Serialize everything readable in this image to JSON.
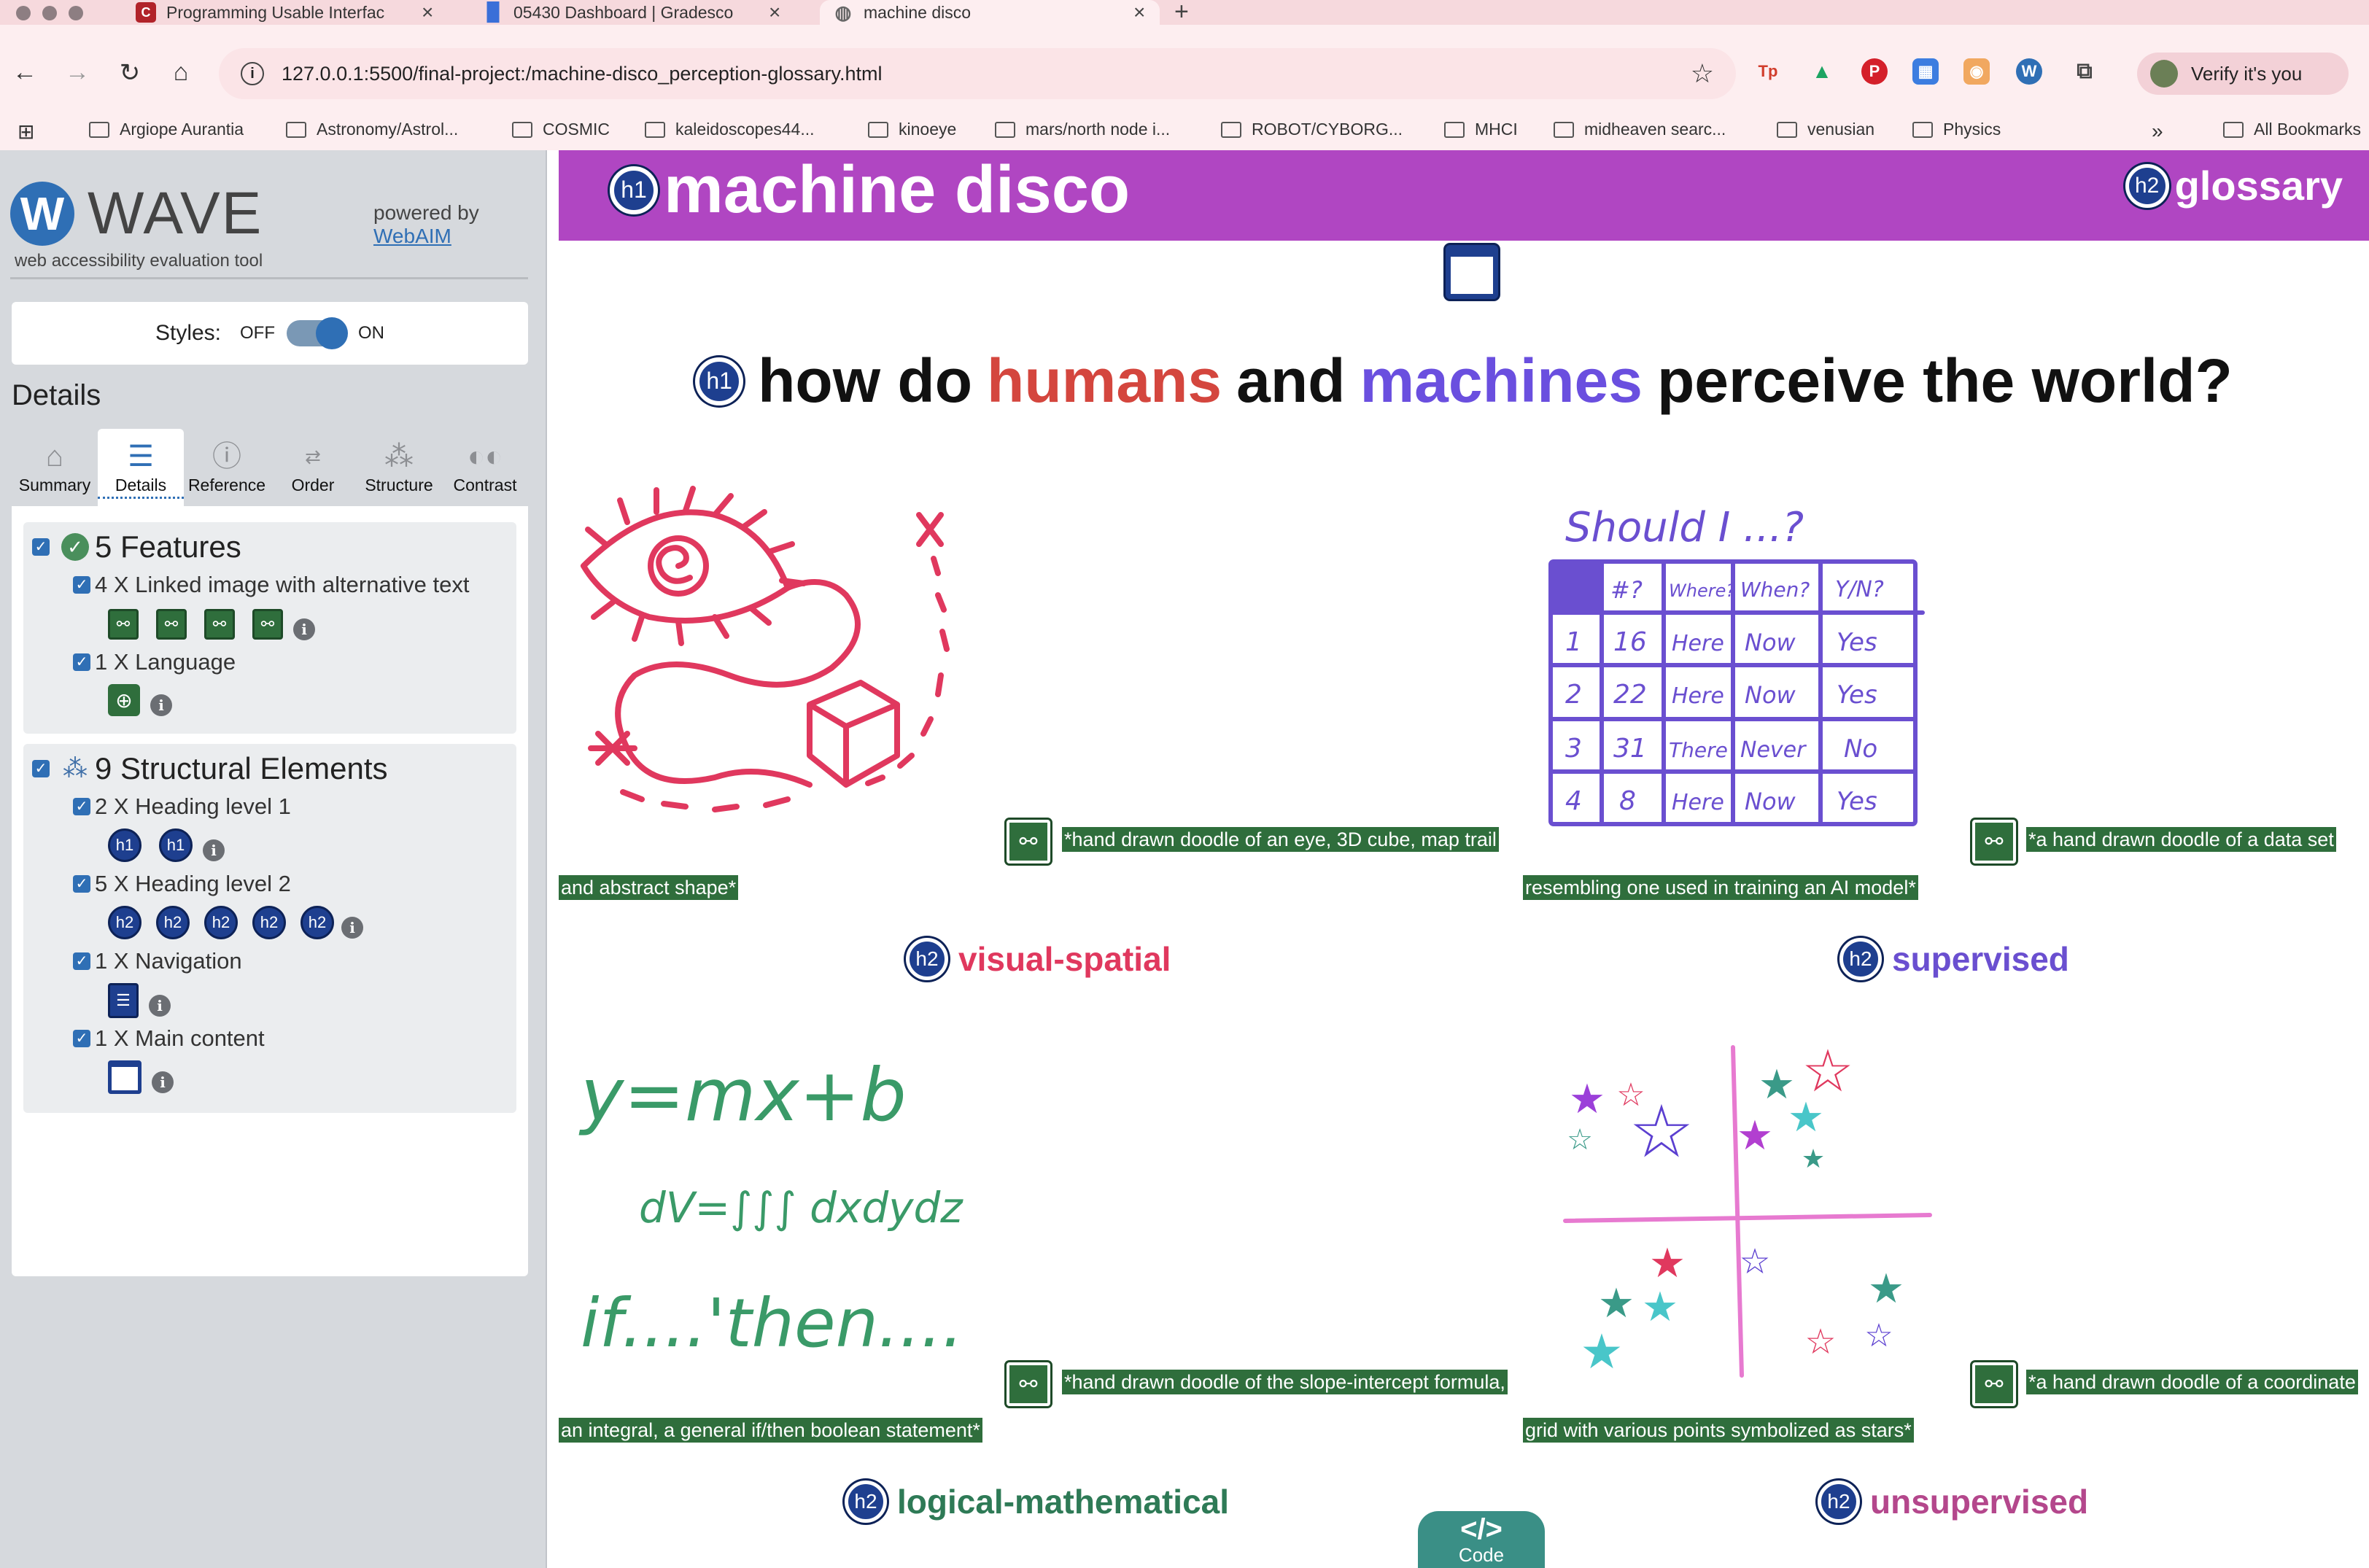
{
  "browser": {
    "tabs": [
      {
        "title": "Programming Usable Interfac",
        "icon": "C",
        "icon_color": "#b1232a"
      },
      {
        "title": "05430 Dashboard | Gradesco",
        "icon": "bar-chart",
        "icon_color": "#3a6fd8"
      },
      {
        "title": "machine disco",
        "icon": "globe",
        "icon_color": "#666666"
      }
    ],
    "url": "127.0.0.1:5500/final-project:/machine-disco_perception-glossary.html",
    "verify_label": "Verify it's you",
    "bookmarks": [
      "Argiope Aurantia",
      "Astronomy/Astrol...",
      "COSMIC",
      "kaleidoscopes44...",
      "kinoeye",
      "mars/north node i...",
      "ROBOT/CYBORG...",
      "MHCI",
      "midheaven searc...",
      "venusian",
      "Physics"
    ],
    "all_bookmarks": "All Bookmarks",
    "chevron": "»"
  },
  "wave": {
    "name": "WAVE",
    "subtitle": "web accessibility evaluation tool",
    "powered_by": "powered by",
    "webaim": "WebAIM",
    "styles_label": "Styles:",
    "off": "OFF",
    "on": "ON",
    "details_heading": "Details",
    "tabs": [
      "Summary",
      "Details",
      "Reference",
      "Order",
      "Structure",
      "Contrast"
    ],
    "features": {
      "title": "5 Features",
      "linked_image": "4 X Linked image with alternative text",
      "language": "1 X Language"
    },
    "structure": {
      "title": "9 Structural Elements",
      "h1": "2 X Heading level 1",
      "h2": "5 X Heading level 2",
      "nav": "1 X Navigation",
      "main": "1 X Main content"
    },
    "h1_badge": "h1",
    "h2_badge": "h2"
  },
  "site": {
    "title": "machine disco",
    "glossary": "glossary",
    "question_start": "how do",
    "question_humans": "humans",
    "question_and": "and",
    "question_machines": "machines",
    "question_end": "perceive the world?",
    "cards": [
      {
        "alt_line1": "*hand drawn doodle of an eye, 3D cube, map trail",
        "alt_line2": "and abstract shape*",
        "heading": "visual-spatial",
        "color": "#e0385e"
      },
      {
        "alt_line1": "*a hand drawn doodle of a data set",
        "alt_line2": "resembling one used in training an AI model*",
        "heading": "supervised",
        "color": "#6a4fd0"
      },
      {
        "alt_line1": "*hand drawn doodle of the slope-intercept formula,",
        "alt_line2": "an integral, a general if/then boolean statement*",
        "heading": "logical-mathematical",
        "color": "#2e7a56"
      },
      {
        "alt_line1": "*a hand drawn doodle of a coordinate",
        "alt_line2": "grid with various points symbolized as stars*",
        "heading": "unsupervised",
        "color": "#b4478c"
      }
    ],
    "doodle_text": {
      "should": "Should I ...?",
      "headers": [
        "#?",
        "Where?",
        "When?",
        "Y/N?"
      ],
      "rows": [
        [
          "1",
          "16",
          "Here",
          "Now",
          "Yes"
        ],
        [
          "2",
          "22",
          "Here",
          "Now",
          "Yes"
        ],
        [
          "3",
          "31",
          "There",
          "Never",
          "No"
        ],
        [
          "4",
          "8",
          "Here",
          "Now",
          "Yes"
        ]
      ],
      "eq1": "y=mx+b",
      "eq2": "dV=∫∫∫ dxdydz",
      "eq3": "if....'then...."
    },
    "code_label": "Code",
    "code_glyph": "</>"
  }
}
